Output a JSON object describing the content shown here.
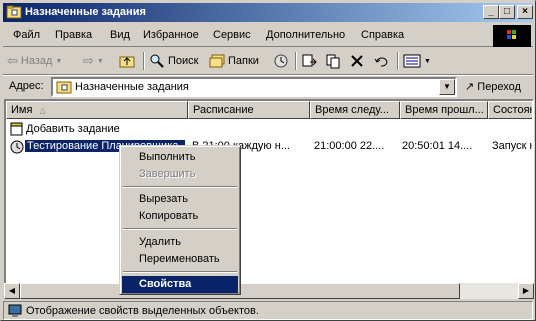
{
  "window": {
    "title": "Назначенные задания",
    "controls": [
      "_",
      "□",
      "×"
    ]
  },
  "menu": [
    "Файл",
    "Правка",
    "Вид",
    "Избранное",
    "Сервис",
    "Дополнительно",
    "Справка"
  ],
  "toolbar": {
    "back": "Назад",
    "search": "Поиск",
    "folders": "Папки"
  },
  "address": {
    "label": "Адрес:",
    "value": "Назначенные задания",
    "go": "Переход"
  },
  "columns": [
    "Имя",
    "Расписание",
    "Время следу...",
    "Время прошл...",
    "Состоян"
  ],
  "rows": [
    {
      "name": "Добавить задание",
      "schedule": "",
      "next": "",
      "last": "",
      "status": ""
    },
    {
      "name": "Тестирование Планировщика",
      "schedule": "В 21:00 каждую н...",
      "next": "21:00:00  22....",
      "last": "20:50:01  14....",
      "status": "Запуск не"
    }
  ],
  "context_menu": {
    "items": [
      {
        "label": "Выполнить",
        "state": "normal"
      },
      {
        "label": "Завершить",
        "state": "disabled"
      },
      {
        "label": "Вырезать",
        "state": "normal"
      },
      {
        "label": "Копировать",
        "state": "normal"
      },
      {
        "label": "Удалить",
        "state": "normal"
      },
      {
        "label": "Переименовать",
        "state": "normal"
      },
      {
        "label": "Свойства",
        "state": "highlighted"
      }
    ]
  },
  "statusbar": {
    "text": "Отображение свойств выделенных объектов."
  },
  "colors": {
    "titlebar": "#0a246a",
    "face": "#d4d0c8",
    "selection": "#0a246a"
  }
}
